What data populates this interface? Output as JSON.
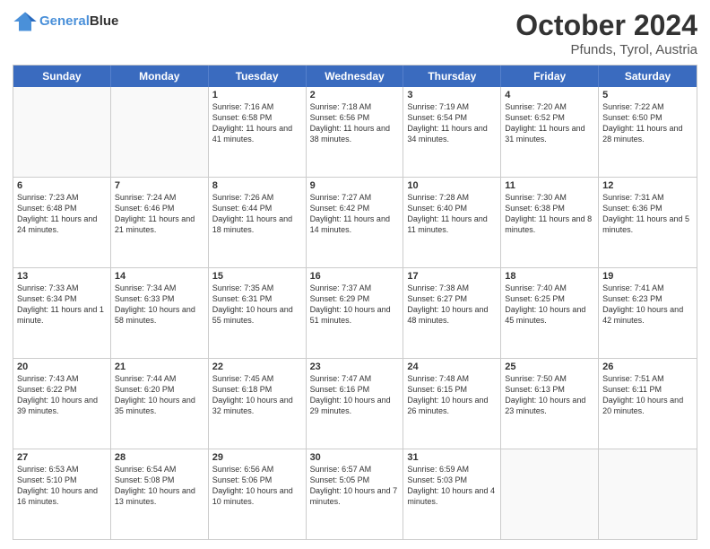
{
  "logo": {
    "line1": "General",
    "line2": "Blue"
  },
  "title": "October 2024",
  "subtitle": "Pfunds, Tyrol, Austria",
  "header_days": [
    "Sunday",
    "Monday",
    "Tuesday",
    "Wednesday",
    "Thursday",
    "Friday",
    "Saturday"
  ],
  "weeks": [
    [
      {
        "day": "",
        "info": "",
        "empty": true
      },
      {
        "day": "",
        "info": "",
        "empty": true
      },
      {
        "day": "1",
        "info": "Sunrise: 7:16 AM\nSunset: 6:58 PM\nDaylight: 11 hours and 41 minutes."
      },
      {
        "day": "2",
        "info": "Sunrise: 7:18 AM\nSunset: 6:56 PM\nDaylight: 11 hours and 38 minutes."
      },
      {
        "day": "3",
        "info": "Sunrise: 7:19 AM\nSunset: 6:54 PM\nDaylight: 11 hours and 34 minutes."
      },
      {
        "day": "4",
        "info": "Sunrise: 7:20 AM\nSunset: 6:52 PM\nDaylight: 11 hours and 31 minutes."
      },
      {
        "day": "5",
        "info": "Sunrise: 7:22 AM\nSunset: 6:50 PM\nDaylight: 11 hours and 28 minutes."
      }
    ],
    [
      {
        "day": "6",
        "info": "Sunrise: 7:23 AM\nSunset: 6:48 PM\nDaylight: 11 hours and 24 minutes."
      },
      {
        "day": "7",
        "info": "Sunrise: 7:24 AM\nSunset: 6:46 PM\nDaylight: 11 hours and 21 minutes."
      },
      {
        "day": "8",
        "info": "Sunrise: 7:26 AM\nSunset: 6:44 PM\nDaylight: 11 hours and 18 minutes."
      },
      {
        "day": "9",
        "info": "Sunrise: 7:27 AM\nSunset: 6:42 PM\nDaylight: 11 hours and 14 minutes."
      },
      {
        "day": "10",
        "info": "Sunrise: 7:28 AM\nSunset: 6:40 PM\nDaylight: 11 hours and 11 minutes."
      },
      {
        "day": "11",
        "info": "Sunrise: 7:30 AM\nSunset: 6:38 PM\nDaylight: 11 hours and 8 minutes."
      },
      {
        "day": "12",
        "info": "Sunrise: 7:31 AM\nSunset: 6:36 PM\nDaylight: 11 hours and 5 minutes."
      }
    ],
    [
      {
        "day": "13",
        "info": "Sunrise: 7:33 AM\nSunset: 6:34 PM\nDaylight: 11 hours and 1 minute."
      },
      {
        "day": "14",
        "info": "Sunrise: 7:34 AM\nSunset: 6:33 PM\nDaylight: 10 hours and 58 minutes."
      },
      {
        "day": "15",
        "info": "Sunrise: 7:35 AM\nSunset: 6:31 PM\nDaylight: 10 hours and 55 minutes."
      },
      {
        "day": "16",
        "info": "Sunrise: 7:37 AM\nSunset: 6:29 PM\nDaylight: 10 hours and 51 minutes."
      },
      {
        "day": "17",
        "info": "Sunrise: 7:38 AM\nSunset: 6:27 PM\nDaylight: 10 hours and 48 minutes."
      },
      {
        "day": "18",
        "info": "Sunrise: 7:40 AM\nSunset: 6:25 PM\nDaylight: 10 hours and 45 minutes."
      },
      {
        "day": "19",
        "info": "Sunrise: 7:41 AM\nSunset: 6:23 PM\nDaylight: 10 hours and 42 minutes."
      }
    ],
    [
      {
        "day": "20",
        "info": "Sunrise: 7:43 AM\nSunset: 6:22 PM\nDaylight: 10 hours and 39 minutes."
      },
      {
        "day": "21",
        "info": "Sunrise: 7:44 AM\nSunset: 6:20 PM\nDaylight: 10 hours and 35 minutes."
      },
      {
        "day": "22",
        "info": "Sunrise: 7:45 AM\nSunset: 6:18 PM\nDaylight: 10 hours and 32 minutes."
      },
      {
        "day": "23",
        "info": "Sunrise: 7:47 AM\nSunset: 6:16 PM\nDaylight: 10 hours and 29 minutes."
      },
      {
        "day": "24",
        "info": "Sunrise: 7:48 AM\nSunset: 6:15 PM\nDaylight: 10 hours and 26 minutes."
      },
      {
        "day": "25",
        "info": "Sunrise: 7:50 AM\nSunset: 6:13 PM\nDaylight: 10 hours and 23 minutes."
      },
      {
        "day": "26",
        "info": "Sunrise: 7:51 AM\nSunset: 6:11 PM\nDaylight: 10 hours and 20 minutes."
      }
    ],
    [
      {
        "day": "27",
        "info": "Sunrise: 6:53 AM\nSunset: 5:10 PM\nDaylight: 10 hours and 16 minutes."
      },
      {
        "day": "28",
        "info": "Sunrise: 6:54 AM\nSunset: 5:08 PM\nDaylight: 10 hours and 13 minutes."
      },
      {
        "day": "29",
        "info": "Sunrise: 6:56 AM\nSunset: 5:06 PM\nDaylight: 10 hours and 10 minutes."
      },
      {
        "day": "30",
        "info": "Sunrise: 6:57 AM\nSunset: 5:05 PM\nDaylight: 10 hours and 7 minutes."
      },
      {
        "day": "31",
        "info": "Sunrise: 6:59 AM\nSunset: 5:03 PM\nDaylight: 10 hours and 4 minutes."
      },
      {
        "day": "",
        "info": "",
        "empty": true
      },
      {
        "day": "",
        "info": "",
        "empty": true
      }
    ]
  ]
}
